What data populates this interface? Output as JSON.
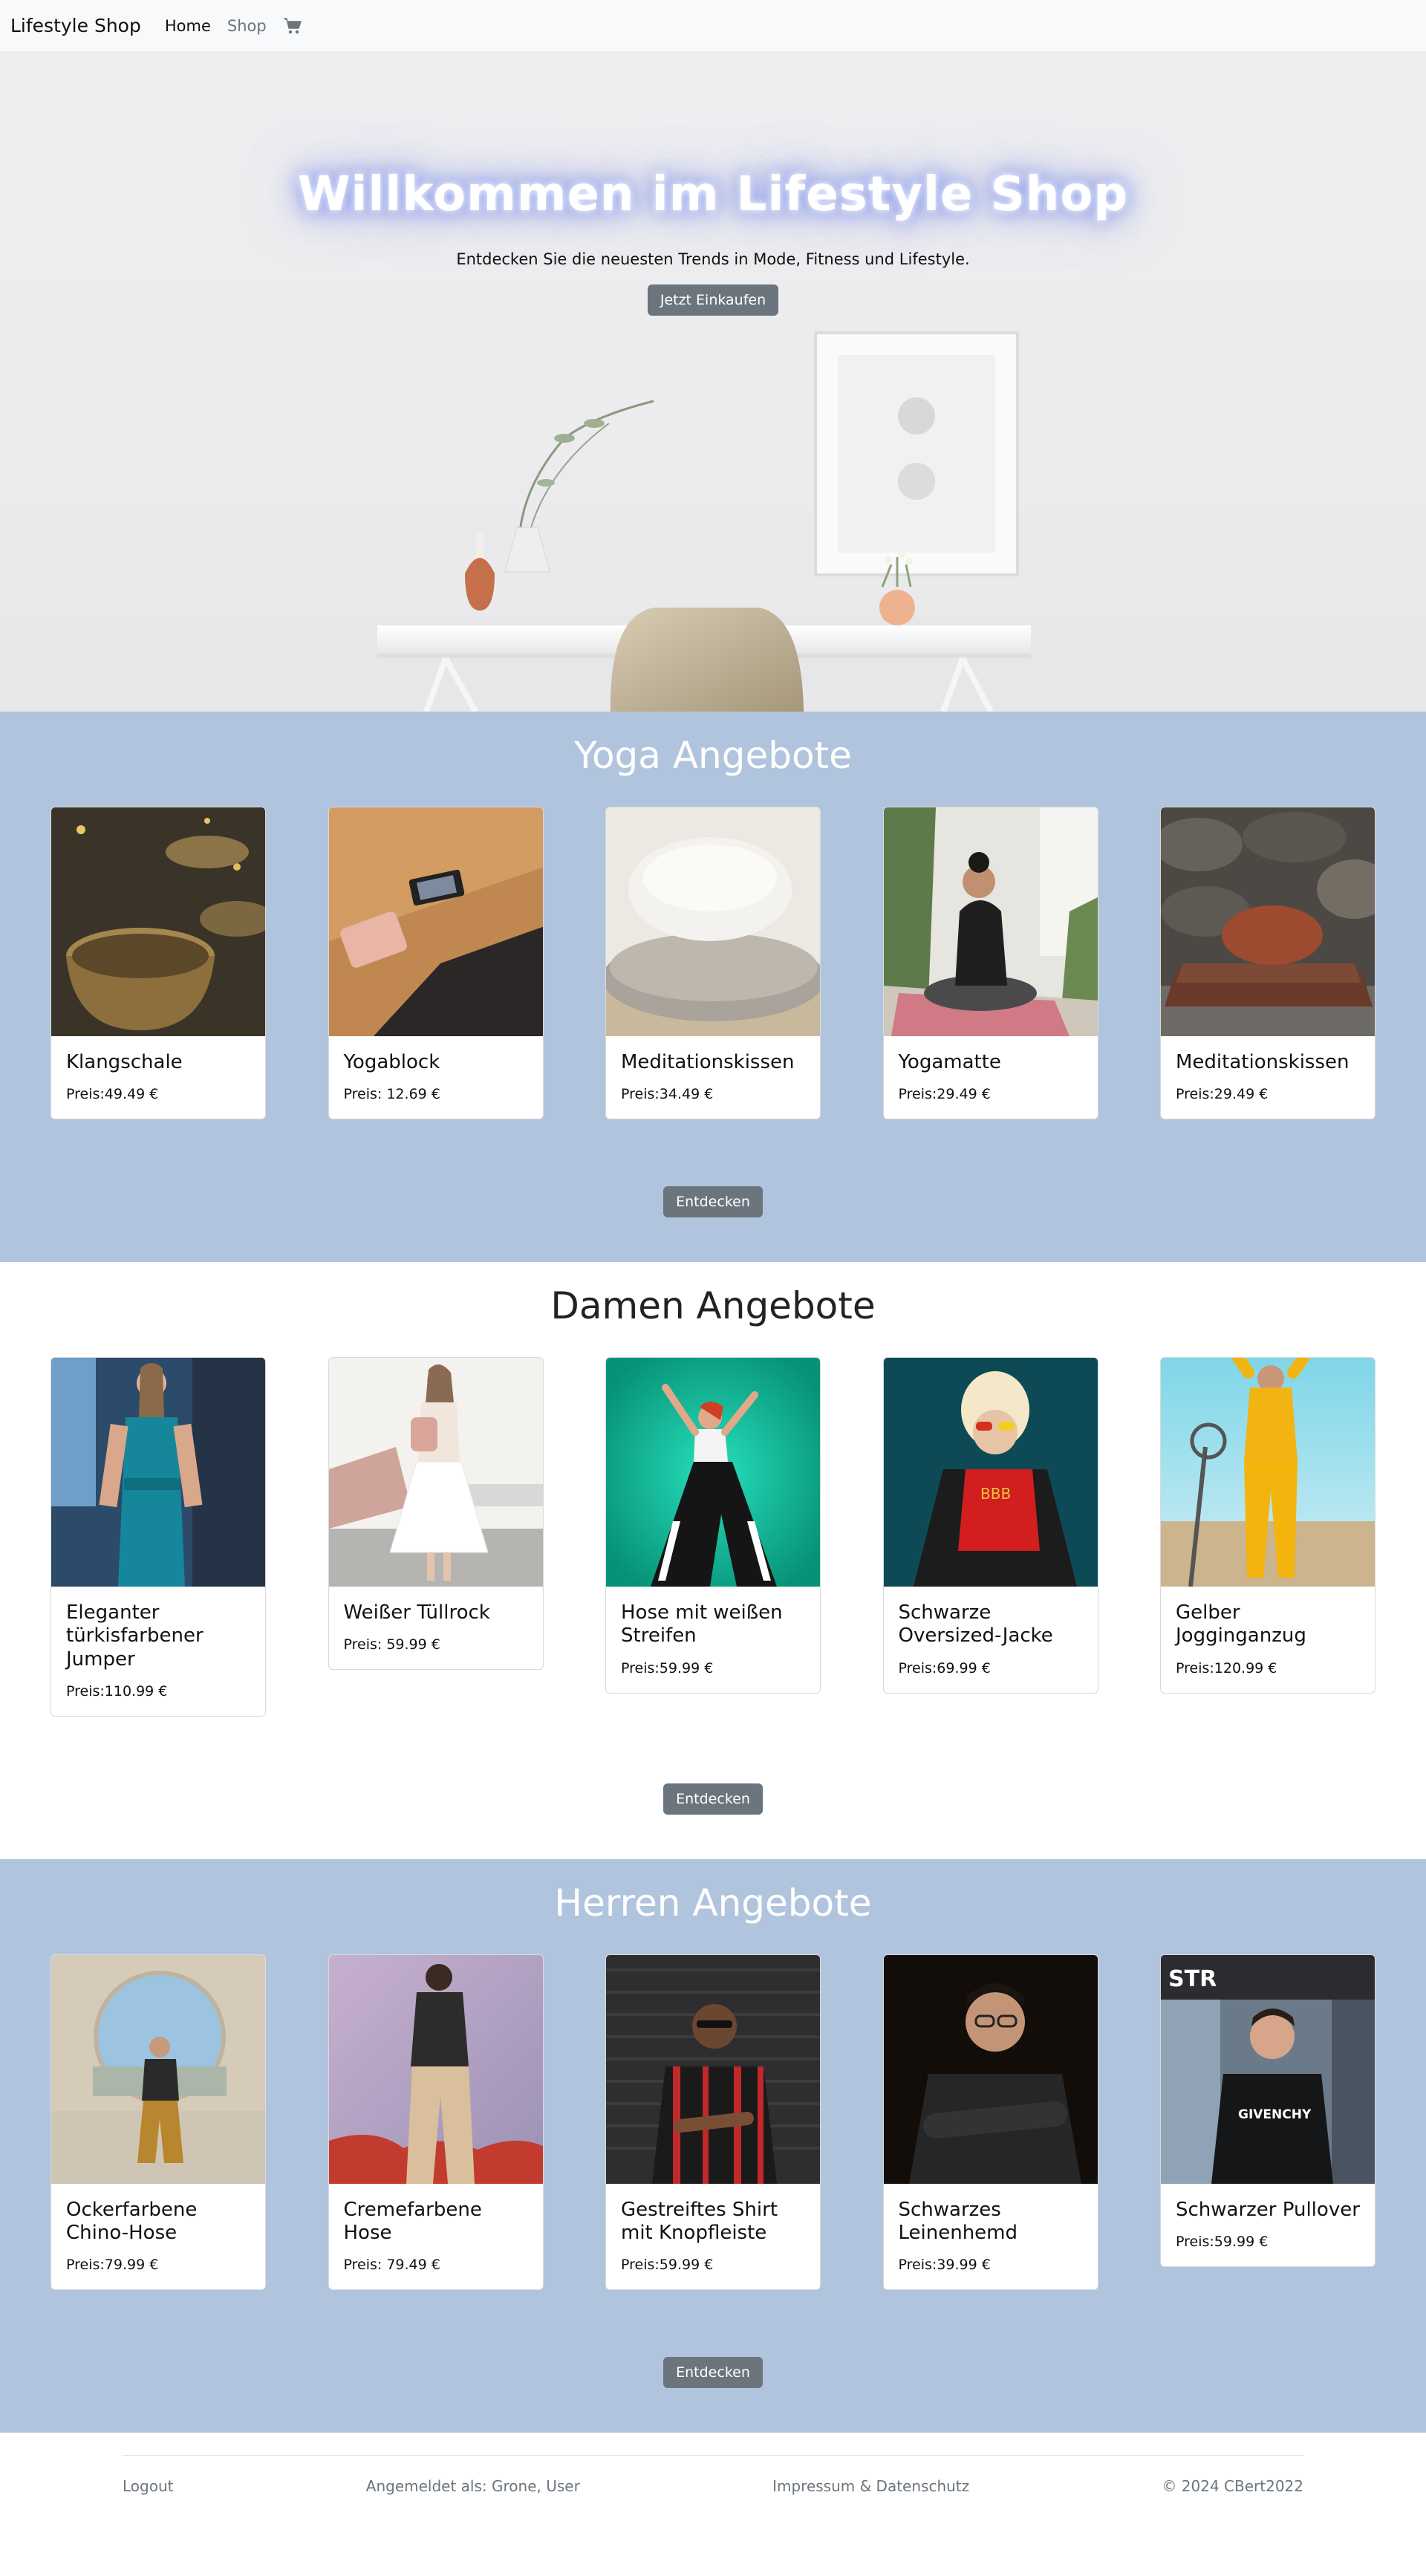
{
  "navbar": {
    "brand": "Lifestyle Shop",
    "links": [
      {
        "label": "Home",
        "active": true
      },
      {
        "label": "Shop",
        "active": false
      }
    ],
    "cart_icon": "shopping-cart-icon"
  },
  "hero": {
    "title": "Willkommen im Lifestyle Shop",
    "subtitle": "Entdecken Sie die neuesten Trends in Mode, Fitness und Lifestyle.",
    "button": "Jetzt Einkaufen"
  },
  "sections": [
    {
      "title": "Yoga Angebote",
      "button": "Entdecken",
      "products": [
        {
          "name": "Klangschale",
          "price": "Preis:49.49 €"
        },
        {
          "name": "Yogablock",
          "price": "Preis: 12.69 €"
        },
        {
          "name": "Meditationskissen",
          "price": "Preis:34.49 €"
        },
        {
          "name": "Yogamatte",
          "price": "Preis:29.49 €"
        },
        {
          "name": "Meditationskissen",
          "price": "Preis:29.49 €"
        }
      ]
    },
    {
      "title": "Damen Angebote",
      "button": "Entdecken",
      "products": [
        {
          "name": "Eleganter türkisfarbener Jumper",
          "price": "Preis:110.99 €"
        },
        {
          "name": "Weißer Tüllrock",
          "price": "Preis: 59.99 €"
        },
        {
          "name": "Hose mit weißen Streifen",
          "price": "Preis:59.99 €"
        },
        {
          "name": "Schwarze Oversized-Jacke",
          "price": "Preis:69.99 €"
        },
        {
          "name": "Gelber Jogginganzug",
          "price": "Preis:120.99 €"
        }
      ]
    },
    {
      "title": "Herren Angebote",
      "button": "Entdecken",
      "products": [
        {
          "name": "Ockerfarbene Chino-Hose",
          "price": "Preis:79.99 €"
        },
        {
          "name": "Cremefarbene Hose",
          "price": "Preis: 79.49 €"
        },
        {
          "name": "Gestreiftes Shirt mit Knopfleiste",
          "price": "Preis:59.99 €"
        },
        {
          "name": "Schwarzes Leinenhemd",
          "price": "Preis:39.99 €"
        },
        {
          "name": "Schwarzer Pullover",
          "price": "Preis:59.99 €"
        }
      ]
    }
  ],
  "footer": {
    "logout": "Logout",
    "logged_in": "Angemeldet als: Grone, User",
    "imprint": "Impressum & Datenschutz",
    "copyright": "© 2024 CBert2022"
  },
  "colors": {
    "section_blue": "#b0c4de",
    "button_gray": "#6c757d",
    "navbar_bg": "#f8f9fa"
  }
}
